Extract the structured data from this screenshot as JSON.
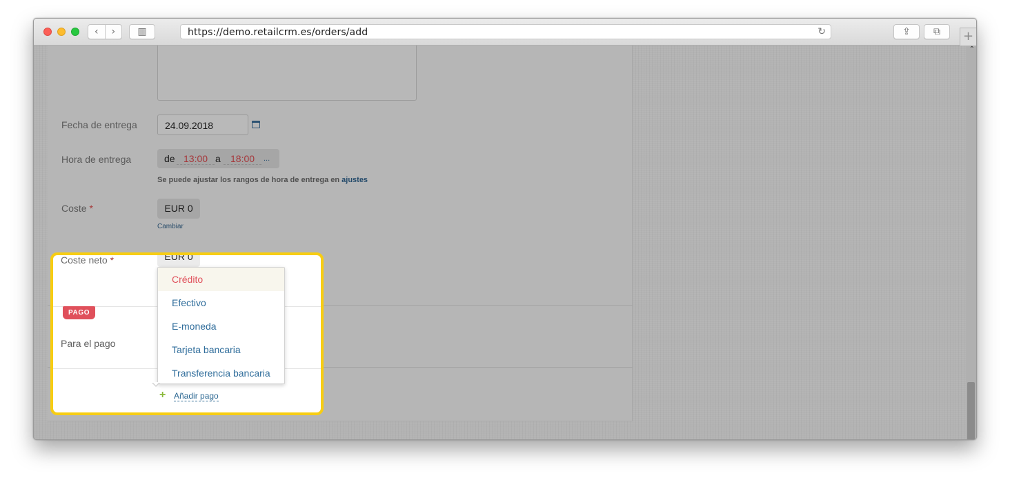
{
  "browser": {
    "url": "https://demo.retailcrm.es/orders/add",
    "back_glyph": "‹",
    "forward_glyph": "›",
    "reload_glyph": "↻",
    "newtab_glyph": "+",
    "share_glyph": "⇪",
    "tabs_glyph": "⧉",
    "sidebar_glyph": "▥"
  },
  "form": {
    "delivery_date_label": "Fecha de entrega",
    "delivery_date_value": "24.09.2018",
    "delivery_time_label": "Hora de entrega",
    "time_from_prefix": "de",
    "time_from": "13:00",
    "time_to_prefix": "a",
    "time_to": "18:00",
    "time_more": "...",
    "time_hint": "Se puede ajustar los rangos de hora de entrega en",
    "time_hint_link": "ajustes",
    "cost_label": "Coste",
    "required_mark": "*",
    "cost_value": "EUR 0",
    "change_link": "Cambiar",
    "net_cost_label": "Coste neto",
    "net_cost_value": "EUR 0"
  },
  "payment": {
    "section_badge": "PAGO",
    "for_payment_label": "Para el pago",
    "add_plus": "+",
    "add_payment_link": "Añadir pago"
  },
  "dropdown": {
    "items": [
      {
        "label": "Crédito"
      },
      {
        "label": "Efectivo"
      },
      {
        "label": "E-moneda"
      },
      {
        "label": "Tarjeta bancaria"
      },
      {
        "label": "Transferencia bancaria"
      }
    ],
    "active_index": 0
  },
  "scrollbar": {
    "up_glyph": "⌃"
  },
  "colors": {
    "highlight": "#f7cd13",
    "badge": "#e0505b",
    "link": "#2f6d9b",
    "plus": "#8ab93a"
  }
}
